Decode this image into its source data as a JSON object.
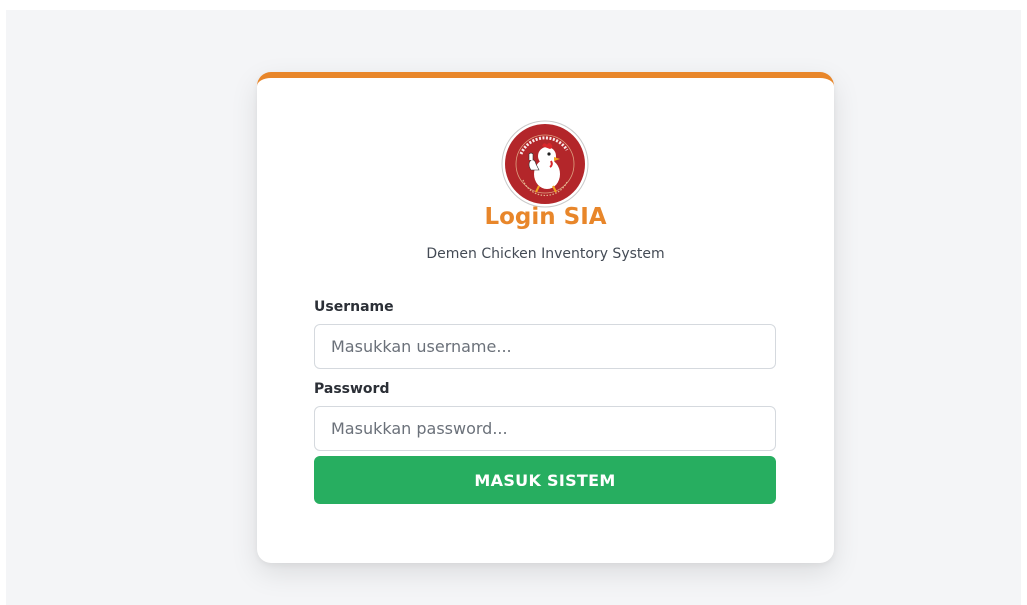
{
  "login": {
    "title": "Login SIA",
    "subtitle": "Demen Chicken Inventory System",
    "logo_text": "DEMEN CHICKEN",
    "username_label": "Username",
    "username_placeholder": "Masukkan username...",
    "username_value": "",
    "password_label": "Password",
    "password_placeholder": "Masukkan password...",
    "password_value": "",
    "submit_label": "MASUK SISTEM"
  },
  "colors": {
    "accent": "#e8862a",
    "primary_button": "#27ae60",
    "logo_red": "#b3262a",
    "background": "#f4f5f7"
  }
}
